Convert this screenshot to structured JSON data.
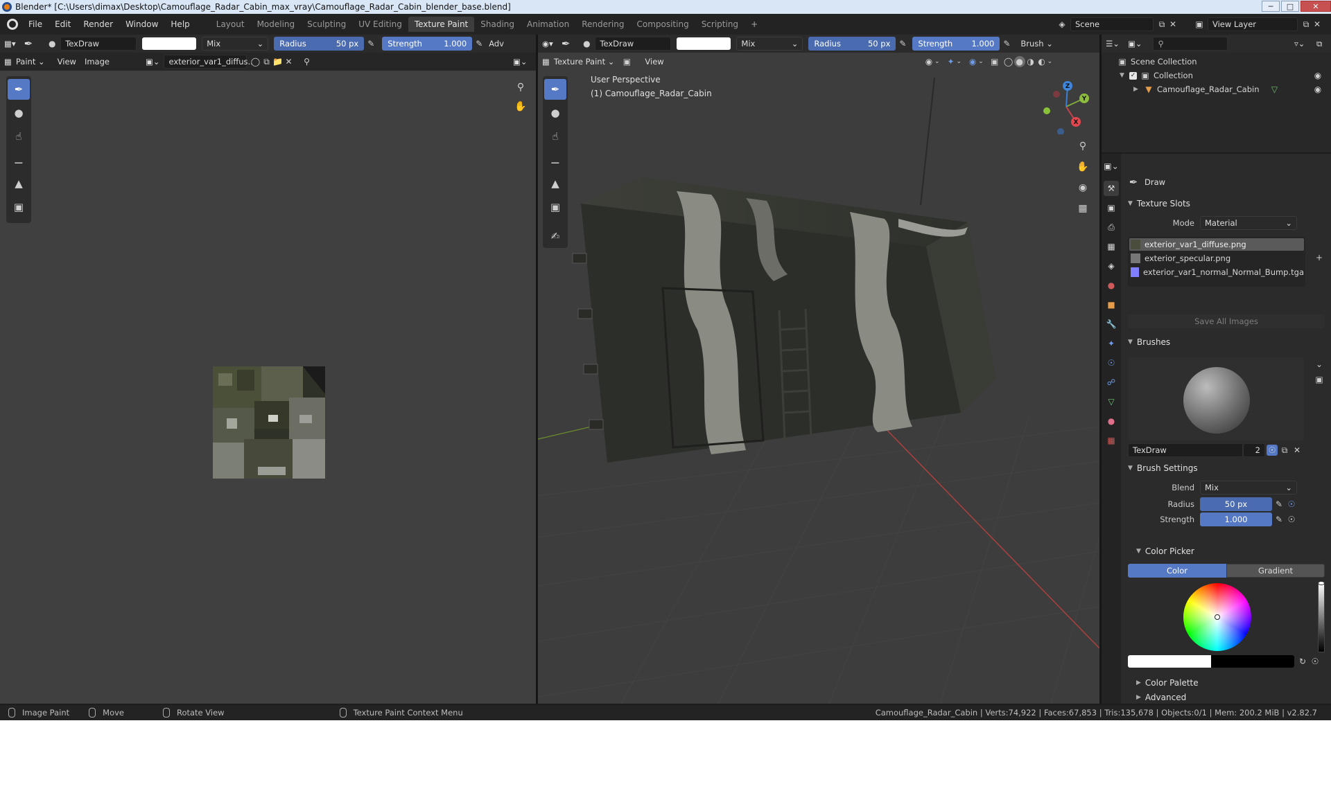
{
  "window": {
    "title": "Blender* [C:\\Users\\dimax\\Desktop\\Camouflage_Radar_Cabin_max_vray\\Camouflage_Radar_Cabin_blender_base.blend]",
    "minimize": "─",
    "maximize": "□",
    "close": "✕"
  },
  "menu": [
    "File",
    "Edit",
    "Render",
    "Window",
    "Help"
  ],
  "workspaces": {
    "tabs": [
      "Layout",
      "Modeling",
      "Sculpting",
      "UV Editing",
      "Texture Paint",
      "Shading",
      "Animation",
      "Rendering",
      "Compositing",
      "Scripting"
    ],
    "active": "Texture Paint",
    "add": "+"
  },
  "scene": {
    "name": "Scene",
    "view_layer": "View Layer"
  },
  "image_editor": {
    "brush_name": "TexDraw",
    "blend": "Mix",
    "radius_label": "Radius",
    "radius_value": "50 px",
    "strength_label": "Strength",
    "strength_value": "1.000",
    "adv": "Adv",
    "mode": "Paint",
    "view": "View",
    "image_menu": "Image",
    "image_name": "exterior_var1_diffus.."
  },
  "viewport": {
    "brush_name": "TexDraw",
    "blend": "Mix",
    "radius_label": "Radius",
    "radius_value": "50 px",
    "strength_label": "Strength",
    "strength_value": "1.000",
    "brush_menu": "Brush",
    "mode": "Texture Paint",
    "view": "View",
    "perspective": "User Perspective",
    "object_label": "(1) Camouflage_Radar_Cabin",
    "gizmo": {
      "x": "X",
      "y": "Y",
      "z": "Z"
    }
  },
  "outliner": {
    "root": "Scene Collection",
    "collection": "Collection",
    "object": "Camouflage_Radar_Cabin"
  },
  "properties": {
    "tool_name": "Draw",
    "texture_slots": {
      "header": "Texture Slots",
      "mode_label": "Mode",
      "mode_value": "Material",
      "slots": [
        "exterior_var1_diffuse.png",
        "exterior_specular.png",
        "exterior_var1_normal_Normal_Bump.tga"
      ],
      "save_all": "Save All Images"
    },
    "brushes": {
      "header": "Brushes",
      "brush_name": "TexDraw",
      "users": "2"
    },
    "brush_settings": {
      "header": "Brush Settings",
      "blend_label": "Blend",
      "blend_value": "Mix",
      "radius_label": "Radius",
      "radius_value": "50 px",
      "strength_label": "Strength",
      "strength_value": "1.000"
    },
    "color_picker": {
      "header": "Color Picker",
      "tab_color": "Color",
      "tab_gradient": "Gradient"
    },
    "color_palette": "Color Palette",
    "advanced": "Advanced"
  },
  "statusbar": {
    "image_paint": "Image Paint",
    "move": "Move",
    "rotate_view": "Rotate View",
    "context_menu": "Texture Paint Context Menu",
    "stats": "Camouflage_Radar_Cabin | Verts:74,922 | Faces:67,853 | Tris:135,678 | Objects:0/1 | Mem: 200.2 MiB | v2.82.7"
  },
  "colors": {
    "accent": "#5679c6",
    "header": "#2b2b2b",
    "panel": "#2b2b2b",
    "viewport_bg": "#3d3d3d",
    "image_bg": "#404040"
  }
}
